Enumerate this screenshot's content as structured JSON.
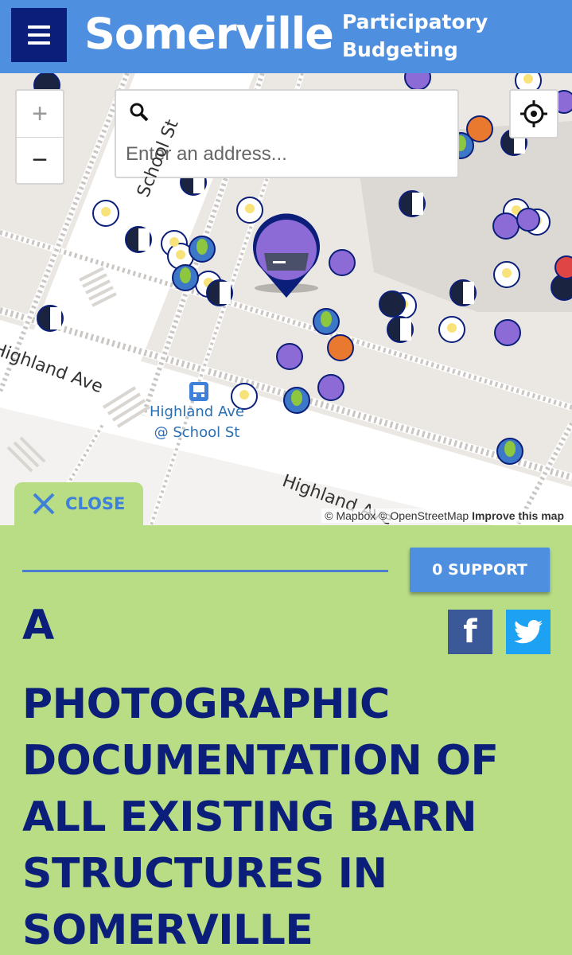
{
  "header": {
    "brand": "Somerville",
    "subtitle_line1": "Participatory",
    "subtitle_line2": "Budgeting",
    "menu_icon": "hamburger-icon"
  },
  "map": {
    "zoom_in_label": "+",
    "zoom_out_label": "−",
    "search_placeholder": "Enter an address...",
    "streets": {
      "school_st": "School St",
      "highland_ave": "Highland Ave",
      "highland_ave_2": "Highland Ave"
    },
    "bus_stop": {
      "line1": "Highland Ave",
      "line2": "@ School St"
    },
    "attribution": {
      "mapbox": "© Mapbox",
      "osm": "© OpenStreetMap",
      "improve": "Improve this map"
    },
    "close_label": "CLOSE"
  },
  "panel": {
    "support_label": "0 SUPPORT",
    "title_first": "A",
    "title_rest": "PHOTOGRAPHIC DOCUMENTATION OF ALL EXISTING BARN STRUCTURES IN SOMERVILLE",
    "share": {
      "facebook": "facebook-icon",
      "twitter": "twitter-icon"
    }
  },
  "colors": {
    "header_bg": "#4f8fe0",
    "menu_bg": "#0b1f7a",
    "panel_bg": "#b9dd85",
    "title_color": "#0b1f7a",
    "accent": "#3f80d8"
  }
}
